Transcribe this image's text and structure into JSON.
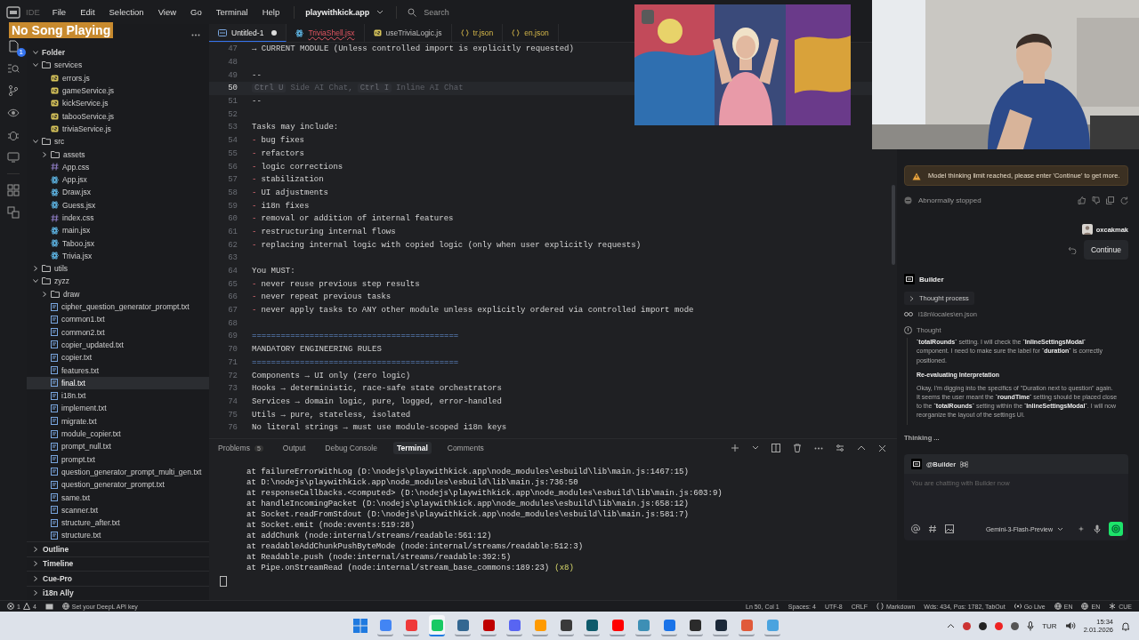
{
  "titlebar": {
    "app_name": "IDE",
    "menu": [
      "File",
      "Edit",
      "Selection",
      "View",
      "Go",
      "Terminal",
      "Help"
    ],
    "project": "playwithkick.app",
    "search_placeholder": "Search"
  },
  "overlay": {
    "now_playing": "No Song Playing"
  },
  "activity_bar": {
    "explorer_badge": "1"
  },
  "sidebar": {
    "root": {
      "label": "Folder",
      "expanded": true,
      "children": [
        {
          "label": "services",
          "kind": "folder",
          "expanded": true,
          "selected": false,
          "children": [
            {
              "label": "errors.js",
              "kind": "js",
              "selected": false
            },
            {
              "label": "gameService.js",
              "kind": "js",
              "selected": false
            },
            {
              "label": "kickService.js",
              "kind": "js",
              "selected": false
            },
            {
              "label": "tabooService.js",
              "kind": "js",
              "selected": false
            },
            {
              "label": "triviaService.js",
              "kind": "js",
              "selected": false
            }
          ]
        },
        {
          "label": "src",
          "kind": "folder",
          "expanded": true,
          "selected": false,
          "children": [
            {
              "label": "assets",
              "kind": "folder",
              "expanded": false,
              "selected": false
            },
            {
              "label": "App.css",
              "kind": "css",
              "selected": false
            },
            {
              "label": "App.jsx",
              "kind": "react",
              "selected": false
            },
            {
              "label": "Draw.jsx",
              "kind": "react",
              "selected": false
            },
            {
              "label": "Guess.jsx",
              "kind": "react",
              "selected": false
            },
            {
              "label": "index.css",
              "kind": "css",
              "selected": false
            },
            {
              "label": "main.jsx",
              "kind": "react",
              "selected": false
            },
            {
              "label": "Taboo.jsx",
              "kind": "react",
              "selected": false
            },
            {
              "label": "Trivia.jsx",
              "kind": "react",
              "selected": false
            }
          ]
        },
        {
          "label": "utils",
          "kind": "folder",
          "expanded": false,
          "selected": false
        },
        {
          "label": "zyzz",
          "kind": "folder",
          "expanded": true,
          "selected": false,
          "children": [
            {
              "label": "draw",
              "kind": "folder",
              "expanded": false,
              "selected": false
            },
            {
              "label": "cipher_question_generator_prompt.txt",
              "kind": "txt",
              "selected": false
            },
            {
              "label": "common1.txt",
              "kind": "txt",
              "selected": false
            },
            {
              "label": "common2.txt",
              "kind": "txt",
              "selected": false
            },
            {
              "label": "copier_updated.txt",
              "kind": "txt",
              "selected": false
            },
            {
              "label": "copier.txt",
              "kind": "txt",
              "selected": false
            },
            {
              "label": "features.txt",
              "kind": "txt",
              "selected": false
            },
            {
              "label": "final.txt",
              "kind": "txt",
              "selected": true
            },
            {
              "label": "i18n.txt",
              "kind": "txt",
              "selected": false
            },
            {
              "label": "implement.txt",
              "kind": "txt",
              "selected": false
            },
            {
              "label": "migrate.txt",
              "kind": "txt",
              "selected": false
            },
            {
              "label": "module_copier.txt",
              "kind": "txt",
              "selected": false
            },
            {
              "label": "prompt_null.txt",
              "kind": "txt",
              "selected": false
            },
            {
              "label": "prompt.txt",
              "kind": "txt",
              "selected": false
            },
            {
              "label": "question_generator_prompt_multi_gen.txt",
              "kind": "txt",
              "selected": false
            },
            {
              "label": "question_generator_prompt.txt",
              "kind": "txt",
              "selected": false
            },
            {
              "label": "same.txt",
              "kind": "txt",
              "selected": false
            },
            {
              "label": "scanner.txt",
              "kind": "txt",
              "selected": false
            },
            {
              "label": "structure_after.txt",
              "kind": "txt",
              "selected": false
            },
            {
              "label": "structure.txt",
              "kind": "txt",
              "selected": false
            }
          ]
        }
      ]
    },
    "sections": [
      "Outline",
      "Timeline",
      "Cue-Pro",
      "i18n Ally"
    ]
  },
  "editor": {
    "tabs": [
      {
        "label": "Untitled-1",
        "kind": "text",
        "selected": true,
        "modified": true,
        "error": false
      },
      {
        "label": "TriviaShell.jsx",
        "kind": "react",
        "selected": false,
        "modified": false,
        "error": true
      },
      {
        "label": "useTriviaLogic.js",
        "kind": "js",
        "selected": false,
        "modified": false,
        "error": false
      },
      {
        "label": "tr.json",
        "kind": "json",
        "selected": false,
        "modified": false,
        "error": false
      },
      {
        "label": "en.json",
        "kind": "json",
        "selected": false,
        "modified": false,
        "error": false
      }
    ],
    "lines": [
      {
        "n": "47",
        "kind": "plain",
        "current": false,
        "text": "→ CURRENT MODULE (Unless controlled import is explicitly requested)"
      },
      {
        "n": "48",
        "kind": "plain",
        "current": false
      },
      {
        "n": "49",
        "kind": "plain",
        "current": false,
        "text": "--"
      },
      {
        "n": "50",
        "kind": "hint",
        "current": true,
        "parts": [
          {
            "key": "Ctrl U",
            "label": "Side AI Chat,"
          },
          {
            "key": "Ctrl I",
            "label": "Inline AI Chat"
          }
        ]
      },
      {
        "n": "51",
        "kind": "plain",
        "current": false,
        "text": "--"
      },
      {
        "n": "52",
        "kind": "plain",
        "current": false
      },
      {
        "n": "53",
        "kind": "plain",
        "current": false,
        "text": "Tasks may include:"
      },
      {
        "n": "54",
        "kind": "bullet",
        "current": false,
        "marker": "-",
        "text": "bug fixes"
      },
      {
        "n": "55",
        "kind": "bullet",
        "current": false,
        "marker": "-",
        "text": "refactors"
      },
      {
        "n": "56",
        "kind": "bullet",
        "current": false,
        "marker": "-",
        "text": "logic corrections"
      },
      {
        "n": "57",
        "kind": "bullet",
        "current": false,
        "marker": "-",
        "text": "stabilization"
      },
      {
        "n": "58",
        "kind": "bullet",
        "current": false,
        "marker": "-",
        "text": "UI adjustments"
      },
      {
        "n": "59",
        "kind": "bullet",
        "current": false,
        "marker": "-",
        "text": "i18n fixes"
      },
      {
        "n": "60",
        "kind": "bullet",
        "current": false,
        "marker": "-",
        "text": "removal or addition of internal features"
      },
      {
        "n": "61",
        "kind": "bullet",
        "current": false,
        "marker": "-",
        "text": "restructuring internal flows"
      },
      {
        "n": "62",
        "kind": "bullet",
        "current": false,
        "marker": "-",
        "text": "replacing internal logic with copied logic (only when user explicitly requests)"
      },
      {
        "n": "63",
        "kind": "plain",
        "current": false
      },
      {
        "n": "64",
        "kind": "plain",
        "current": false,
        "text": "You MUST:"
      },
      {
        "n": "65",
        "kind": "bullet",
        "current": false,
        "marker": "-",
        "text": "never reuse previous step results"
      },
      {
        "n": "66",
        "kind": "bullet",
        "current": false,
        "marker": "-",
        "text": "never repeat previous tasks"
      },
      {
        "n": "67",
        "kind": "bullet",
        "current": false,
        "marker": "-",
        "text": "never apply tasks to ANY other module unless explicitly ordered via controlled import mode"
      },
      {
        "n": "68",
        "kind": "plain",
        "current": false
      },
      {
        "n": "69",
        "kind": "rule",
        "current": false,
        "text": "==========================================="
      },
      {
        "n": "70",
        "kind": "plain",
        "current": false,
        "text": "MANDATORY ENGINEERING RULES"
      },
      {
        "n": "71",
        "kind": "rule",
        "current": false,
        "text": "==========================================="
      },
      {
        "n": "72",
        "kind": "plain",
        "current": false,
        "text": "Components → UI only (zero logic)"
      },
      {
        "n": "73",
        "kind": "plain",
        "current": false,
        "text": "Hooks → deterministic, race-safe state orchestrators"
      },
      {
        "n": "74",
        "kind": "plain",
        "current": false,
        "text": "Services → domain logic, pure, logged, error-handled"
      },
      {
        "n": "75",
        "kind": "plain",
        "current": false,
        "text": "Utils → pure, stateless, isolated"
      },
      {
        "n": "76",
        "kind": "plain",
        "current": false,
        "text": "No literal strings → must use module-scoped i18n keys"
      }
    ]
  },
  "panel": {
    "tabs": [
      {
        "label": "Problems",
        "count": "5",
        "selected": false
      },
      {
        "label": "Output",
        "selected": false
      },
      {
        "label": "Debug Console",
        "selected": false
      },
      {
        "label": "Terminal",
        "selected": true
      },
      {
        "label": "Comments",
        "selected": false
      }
    ],
    "terminal_lines": [
      {
        "text": "at failureErrorWithLog (D:\\nodejs\\playwithkick.app\\node_modules\\esbuild\\lib\\main.js:1467:15)"
      },
      {
        "text": "at D:\\nodejs\\playwithkick.app\\node_modules\\esbuild\\lib\\main.js:736:50"
      },
      {
        "text": "at responseCallbacks.<computed> (D:\\nodejs\\playwithkick.app\\node_modules\\esbuild\\lib\\main.js:603:9)"
      },
      {
        "text": "at handleIncomingPacket (D:\\nodejs\\playwithkick.app\\node_modules\\esbuild\\lib\\main.js:658:12)"
      },
      {
        "text": "at Socket.readFromStdout (D:\\nodejs\\playwithkick.app\\node_modules\\esbuild\\lib\\main.js:581:7)"
      },
      {
        "text": "at Socket.emit (node:events:519:28)"
      },
      {
        "text": "at addChunk (node:internal/streams/readable:561:12)"
      },
      {
        "text": "at readableAddChunkPushByteMode (node:internal/streams/readable:512:3)"
      },
      {
        "text": "at Readable.push (node:internal/streams/readable:392:5)"
      },
      {
        "text": "at Pipe.onStreamRead (node:internal/stream_base_commons:189:23)",
        "suffix": "(x8)"
      }
    ]
  },
  "chat": {
    "warning": "Model thinking limit reached, please enter 'Continue' to get more.",
    "status": "Abnormally stopped",
    "user": "oxcakmak",
    "user_message": "Continue",
    "agent": "Builder",
    "thought_process": "Thought process",
    "file_ref": "i18n\\locales\\en.json",
    "thought_label": "Thought",
    "thought": [
      {
        "kind": "paragraph",
        "text": "**`totalRounds`** setting. I will check the **`InlineSettingsModal`** component. I need to make sure the label for **`duration`** is correctly positioned."
      },
      {
        "kind": "heading",
        "text": "Re-evaluating Interpretation"
      },
      {
        "kind": "paragraph",
        "text": "Okay, I'm digging into the specifics of \"Duration next to question\" again. It seems the user meant the **`roundTime`** setting should be placed close to the **`totalRounds`** setting within the **`InlineSettingsModal`**. I will now reorganize the layout of the settings UI."
      }
    ],
    "thinking": "Thinking ...",
    "composer": {
      "mention": "@Builder",
      "placeholder": "You are chatting with Builder now",
      "model": "Gemini-3-Flash-Preview"
    }
  },
  "status_bar": {
    "errors": "1",
    "warnings": "4",
    "notice": "Set your DeepL API key",
    "items": [
      {
        "text": "Ln 50, Col 1",
        "kind": "position"
      },
      {
        "text": "Spaces: 4",
        "kind": "indent"
      },
      {
        "text": "UTF-8",
        "kind": "encoding"
      },
      {
        "text": "CRLF",
        "kind": "eol"
      },
      {
        "text": "Markdown",
        "kind": "language"
      },
      {
        "text": "Wds: 434, Pos: 1782, TabOut",
        "kind": "stats"
      },
      {
        "text": "Go Live",
        "kind": "live"
      },
      {
        "text": "EN",
        "kind": "locale"
      },
      {
        "text": "EN",
        "kind": "locale"
      },
      {
        "text": "CUE",
        "kind": "cue"
      }
    ]
  },
  "taskbar": {
    "apps": [
      {
        "color": "#4285f4",
        "selected": false
      },
      {
        "color": "#ef3939",
        "selected": false
      },
      {
        "color": "#18c964",
        "selected": true
      },
      {
        "color": "#336791",
        "selected": false
      },
      {
        "color": "#bf0000",
        "selected": false
      },
      {
        "color": "#5865f2",
        "selected": false
      },
      {
        "color": "#ff9a00",
        "selected": false
      },
      {
        "color": "#3a3a3a",
        "selected": false
      },
      {
        "color": "#0e5a6b",
        "selected": false
      },
      {
        "color": "#ff0000",
        "selected": false
      },
      {
        "color": "#3d8fb5",
        "selected": false
      },
      {
        "color": "#1a73e8",
        "selected": false
      },
      {
        "color": "#2b2b2b",
        "selected": false
      },
      {
        "color": "#1b2838",
        "selected": false
      },
      {
        "color": "#e05a3a",
        "selected": false
      },
      {
        "color": "#4aa3df",
        "selected": false
      }
    ],
    "language": "TUR",
    "time": "15:34",
    "date": "2.01.2026"
  }
}
